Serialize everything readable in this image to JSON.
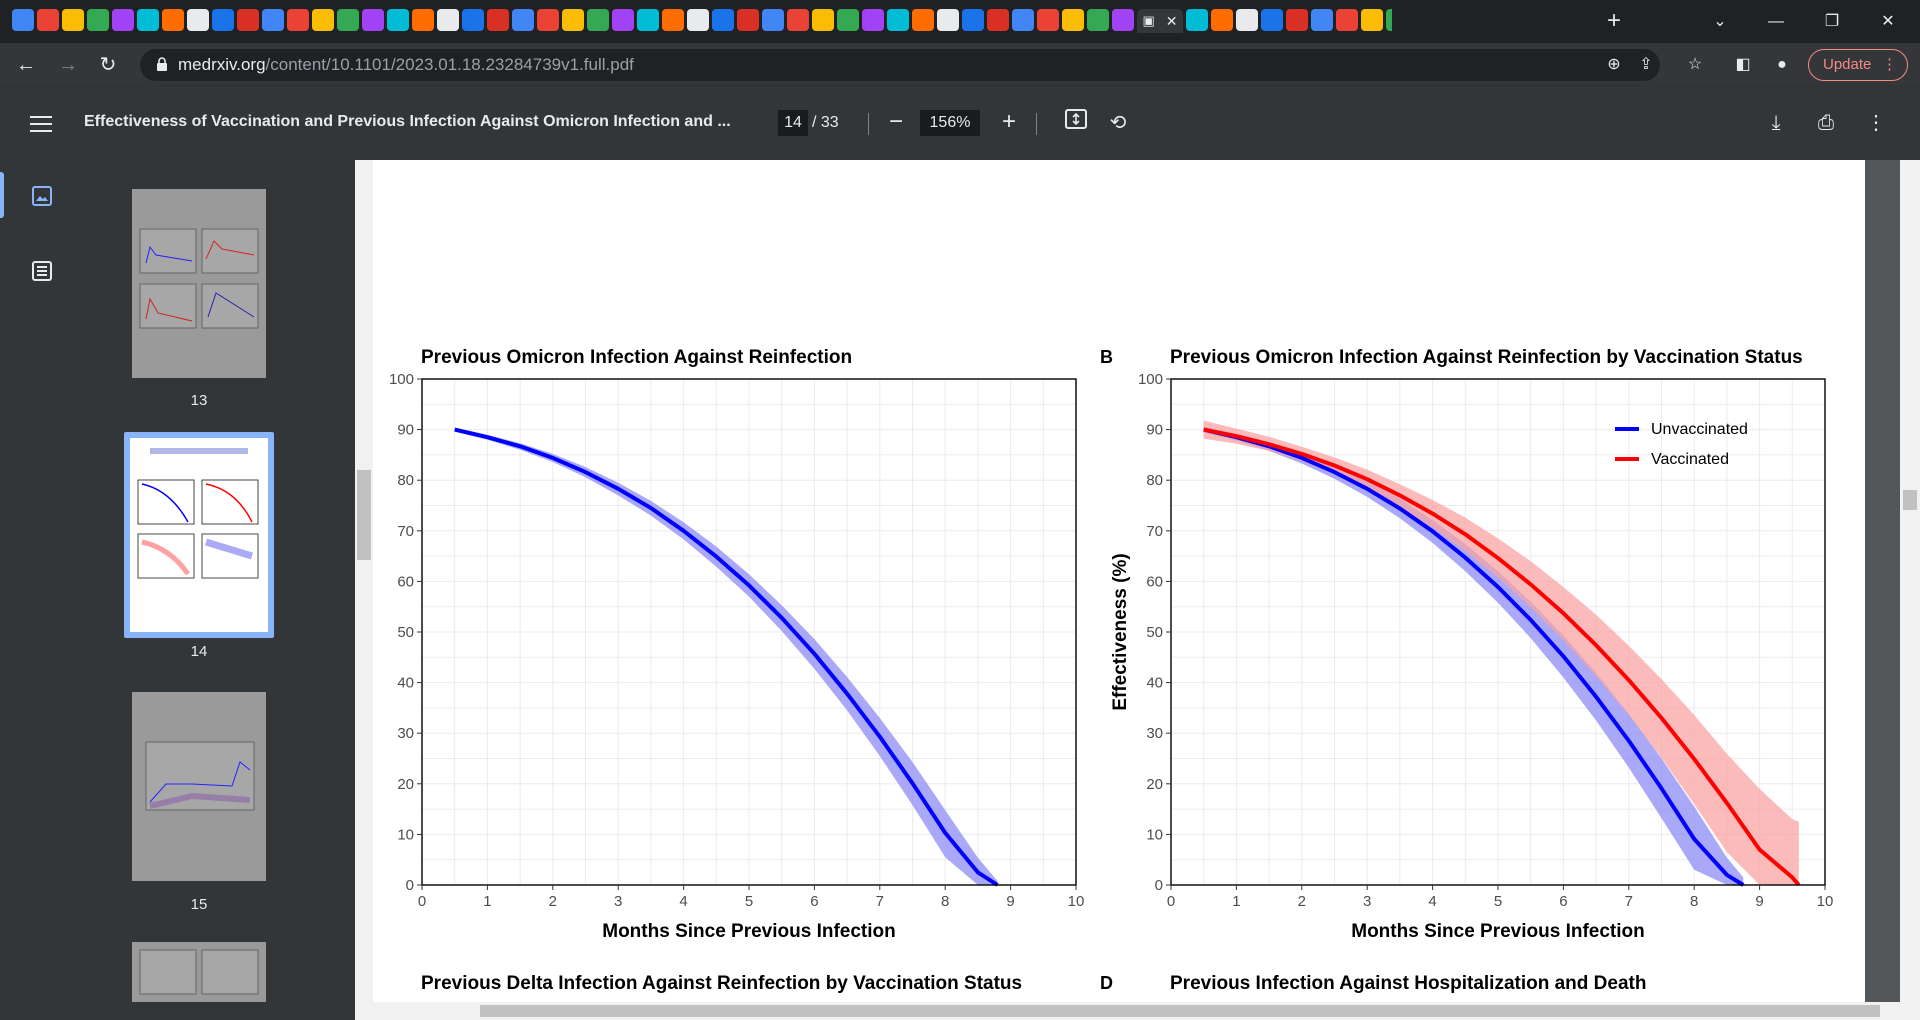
{
  "browser": {
    "active_tab_favicon": "text-icon",
    "new_tab_label": "+",
    "url_host": "medrxiv.org",
    "url_path": "/content/10.1101/2023.01.18.23284739v1.full.pdf",
    "update_label": "Update",
    "favicon_colors": [
      "#4285f4",
      "#ea4335",
      "#fbbc04",
      "#34a853",
      "#a142f4",
      "#00bcd4",
      "#ff6d00",
      "#e8eaed",
      "#1a73e8",
      "#d93025"
    ]
  },
  "pdf": {
    "title": "Effectiveness of Vaccination and Previous Infection Against Omicron Infection and ...",
    "current_page": "14",
    "total_pages": "/ 33",
    "zoom": "156%",
    "thumbnails": [
      {
        "label": "13"
      },
      {
        "label": "14"
      },
      {
        "label": "15"
      }
    ]
  },
  "figure": {
    "panel_a_title": "Previous Omicron Infection Against Reinfection",
    "panel_b_letter": "B",
    "panel_b_title": "Previous Omicron Infection Against Reinfection by Vaccination Status",
    "panel_c_title": "Previous Delta Infection Against Reinfection by Vaccination Status",
    "panel_d_letter": "D",
    "panel_d_title": "Previous Infection Against Hospitalization and Death"
  },
  "chart_data": [
    {
      "type": "line",
      "title": "Previous Omicron Infection Against Reinfection",
      "xlabel": "Months Since Previous Infection",
      "ylabel": "",
      "xlim": [
        0,
        10
      ],
      "ylim": [
        0,
        100
      ],
      "xticks": [
        0,
        1,
        2,
        3,
        4,
        5,
        6,
        7,
        8,
        9,
        10
      ],
      "yticks": [
        0,
        10,
        20,
        30,
        40,
        50,
        60,
        70,
        80,
        90,
        100
      ],
      "grid": true,
      "series": [
        {
          "color": "#0000ff",
          "band_color": "#8c8cf5",
          "x": [
            0.5,
            1,
            1.5,
            2,
            2.5,
            3,
            3.5,
            4,
            4.5,
            5,
            5.5,
            6,
            6.5,
            7,
            7.5,
            8,
            8.5,
            8.8
          ],
          "y": [
            90,
            88.5,
            86.7,
            84.4,
            81.6,
            78.3,
            74.5,
            70,
            64.9,
            59.2,
            52.8,
            45.7,
            37.8,
            29.3,
            20.1,
            10.3,
            2.5,
            0
          ],
          "lower": [
            89.6,
            88,
            86,
            83.6,
            80.6,
            77,
            73,
            68.3,
            62.9,
            57,
            50.2,
            42.7,
            34.5,
            25.5,
            15.8,
            5.5,
            0,
            0
          ],
          "upper": [
            90.4,
            89,
            87.3,
            85.2,
            82.6,
            79.5,
            75.9,
            71.7,
            66.9,
            61.4,
            55.3,
            48.6,
            41.1,
            33,
            24.3,
            14.8,
            5.4,
            0.8
          ]
        }
      ]
    },
    {
      "type": "line",
      "title": "Previous Omicron Infection Against Reinfection by Vaccination Status",
      "xlabel": "Months Since Previous Infection",
      "ylabel": "Effectiveness (%)",
      "xlim": [
        0,
        10
      ],
      "ylim": [
        0,
        100
      ],
      "xticks": [
        0,
        1,
        2,
        3,
        4,
        5,
        6,
        7,
        8,
        9,
        10
      ],
      "yticks": [
        0,
        10,
        20,
        30,
        40,
        50,
        60,
        70,
        80,
        90,
        100
      ],
      "grid": true,
      "legend_position": "top-right",
      "series": [
        {
          "name": "Unvaccinated",
          "color": "#0000ff",
          "band_color": "#8c8cf5",
          "x": [
            0.5,
            1,
            1.5,
            2,
            2.5,
            3,
            3.5,
            4,
            4.5,
            5,
            5.5,
            6,
            6.5,
            7,
            7.5,
            8,
            8.5,
            8.75
          ],
          "y": [
            90,
            88.5,
            86.7,
            84.4,
            81.6,
            78.3,
            74.4,
            69.9,
            64.7,
            58.9,
            52.4,
            45.2,
            37.2,
            28.5,
            19.1,
            9.1,
            2,
            0
          ],
          "lower": [
            89.4,
            87.8,
            85.8,
            83.3,
            80.3,
            76.7,
            72.5,
            67.6,
            62,
            55.8,
            48.8,
            41,
            32.5,
            23.2,
            13.2,
            3,
            0,
            0
          ],
          "upper": [
            90.6,
            89.2,
            87.6,
            85.5,
            82.9,
            79.9,
            76.3,
            72.2,
            67.4,
            62,
            56,
            49.3,
            41.9,
            33.8,
            25,
            15.5,
            5.4,
            1.5
          ]
        },
        {
          "name": "Vaccinated",
          "color": "#ff0000",
          "band_color": "#f9a4a4",
          "x": [
            0.5,
            1,
            1.5,
            2,
            2.5,
            3,
            3.5,
            4,
            4.5,
            5,
            5.5,
            6,
            6.5,
            7,
            7.5,
            8,
            8.5,
            9,
            9.5,
            9.6
          ],
          "y": [
            90,
            88.7,
            87.1,
            85.2,
            82.9,
            80.2,
            77,
            73.4,
            69.3,
            64.6,
            59.4,
            53.7,
            47.4,
            40.5,
            33,
            24.9,
            16.2,
            7,
            1.5,
            0
          ],
          "lower": [
            88.2,
            87.2,
            85.8,
            83.8,
            81.3,
            78.3,
            74.8,
            70.6,
            66,
            60.8,
            54.9,
            48.4,
            41.3,
            33.6,
            25.1,
            16,
            6.5,
            0,
            0,
            0
          ],
          "upper": [
            91.8,
            90.2,
            88.6,
            86.6,
            84.5,
            82.1,
            79.2,
            76.1,
            72.6,
            68.5,
            64,
            58.9,
            53.4,
            47.3,
            40.7,
            33.6,
            25.9,
            19,
            13,
            12.5
          ]
        }
      ]
    }
  ]
}
